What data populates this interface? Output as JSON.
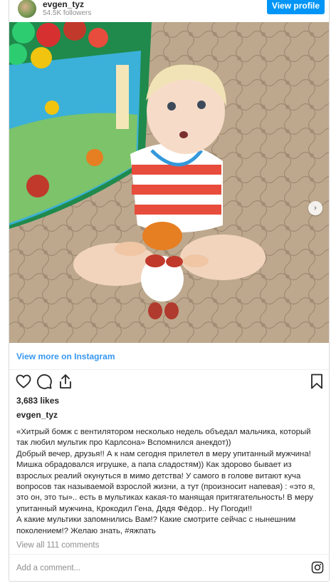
{
  "header": {
    "username": "evgen_tyz",
    "followers": "54.5K followers",
    "view_profile_label": "View profile"
  },
  "photo": {
    "carousel_total": 5,
    "carousel_active_index": 0,
    "next_arrow_glyph": "›"
  },
  "view_more_label": "View more on Instagram",
  "actions": {
    "icons": [
      "heart-icon",
      "comment-icon",
      "share-icon",
      "bookmark-icon"
    ]
  },
  "likes": "3,683 likes",
  "owner_username": "evgen_tyz",
  "caption": {
    "lines": [
      "«Хитрый бомж с вентилятором несколько недель объедал мальчика, который",
      "так любил мультик про Карлсона» Вспомнился анекдот))",
      "Добрый вечер, друзья!! А к нам сегодня прилетел в меру упитанный мужчина!",
      "Мишка обрадовался игрушке, а папа сладостям)) Как здорово бывает из",
      "взрослых реалий окунуться в мимо детства! У самого в голове витают куча",
      "вопросов так называемой взрослой жизни, а тут (произносит напевая) : «это я,",
      "это он, это ты».. есть в мультиках какая-то манящая притягательность! В меру",
      "упитанный мужчина, Крокодил Гена, Дядя Фёдор.. Ну Погоди!!",
      "А какие мультики запомнились Вам!? Какие смотрите сейчас с нынешним",
      "поколением!? Желаю знать, #яжпать"
    ]
  },
  "view_comments_label": "View all 111 comments",
  "comment_placeholder": "Add a comment...",
  "colors": {
    "accent": "#0095f6",
    "link": "#3897f0",
    "muted": "#8e8e8e",
    "text": "#262626"
  }
}
